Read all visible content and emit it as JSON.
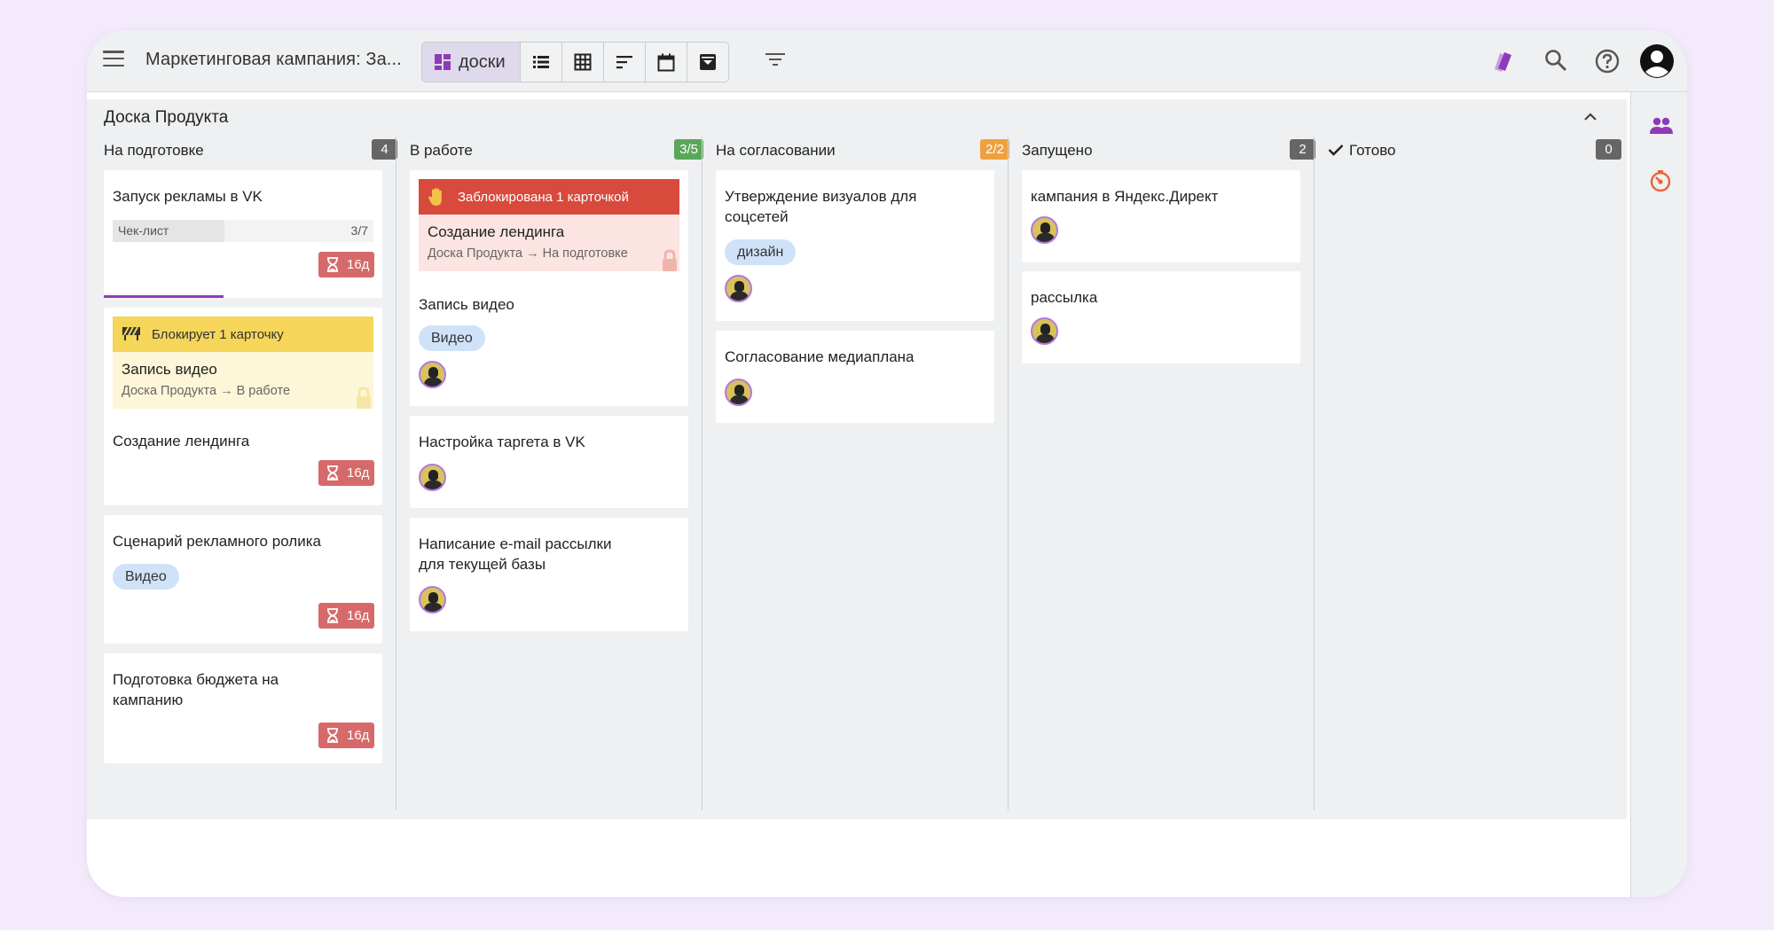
{
  "topbar": {
    "title": "Маркетинговая кампания: За...",
    "active_view_label": "доски",
    "icons": [
      "menu-icon",
      "board-icon",
      "list-icon",
      "table-icon",
      "timeline-icon",
      "calendar-icon",
      "archive-icon",
      "filter-icon",
      "cards-icon",
      "search-icon",
      "help-icon",
      "account-icon"
    ]
  },
  "sidebar": {
    "icons": [
      "team-icon",
      "timer-icon"
    ]
  },
  "board": {
    "title": "Доска Продукта",
    "columns": [
      {
        "name": "На подготовке",
        "count": "4",
        "count_color": "#666666",
        "cards": [
          {
            "title": "Запуск рекламы в VK",
            "checklist_label": "Чек-лист",
            "checklist_count": "3/7",
            "checklist_progress": 0.43,
            "deadline": "16д"
          },
          {
            "blocks_label": "Блокирует 1 карточку",
            "blocks_title": "Запись видео",
            "blocks_path": "Доска Продукта → В работе",
            "title": "Создание лендинга",
            "deadline": "16д"
          },
          {
            "title": "Сценарий рекламного ролика",
            "tag": "Видео",
            "deadline": "16д"
          },
          {
            "title_line1": "Подготовка бюджета на",
            "title_line2": "кампанию",
            "deadline": "16д"
          }
        ]
      },
      {
        "name": "В работе",
        "count": "3/5",
        "count_color": "#5aa75a",
        "cards": [
          {
            "blocked_label": "Заблокирована 1 карточкой",
            "blocked_title": "Создание лендинга",
            "blocked_path": "Доска Продукта → На подготовке",
            "title": "Запись видео",
            "tag": "Видео"
          },
          {
            "title": "Настройка таргета в VK"
          },
          {
            "title_line1": "Написание e-mail рассылки",
            "title_line2": "для текущей базы"
          }
        ]
      },
      {
        "name": "На согласовании",
        "count": "2/2",
        "count_color": "#f0a040",
        "cards": [
          {
            "title_line1": "Утверждение визуалов для",
            "title_line2": "соцсетей",
            "tag": "дизайн"
          },
          {
            "title": "Согласование медиаплана"
          }
        ]
      },
      {
        "name": "Запущено",
        "count": "2",
        "count_color": "#666666",
        "cards": [
          {
            "title": "кампания в Яндекс.Директ"
          },
          {
            "title": "рассылка"
          }
        ]
      },
      {
        "name": "Готово",
        "count": "0",
        "count_color": "#666666",
        "cards": []
      }
    ]
  },
  "colors": {
    "accent": "#8e3bb8",
    "deadline": "#d66a6a",
    "blocked": "#d84a3c",
    "blocks": "#f5d55a",
    "tag": "#cfe2f8",
    "timer": "#e8643a"
  }
}
